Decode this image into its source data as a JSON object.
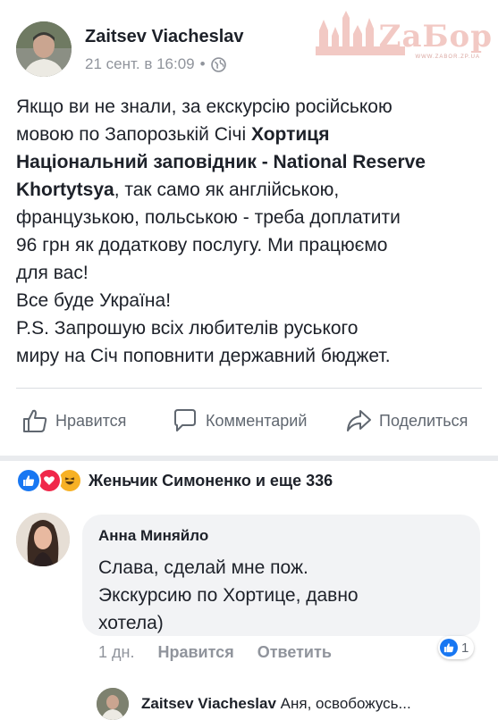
{
  "post": {
    "author": "Zaitsev Viacheslav",
    "timestamp": "21 сент. в 16:09",
    "separator": "•",
    "privacy_icon": "globe-icon",
    "body": {
      "line1": "Якщо ви не знали, за екскурсію російською",
      "line2": "мовою по Запорозькій Січі ",
      "line2_bold": "Хортиця",
      "line3_bold": "Національний заповідник - National Reserve",
      "line4_bold": "Khortytsya",
      "line4": ", так само як англійською,",
      "line5": "французькою, польською - треба доплатити",
      "line6": "96 грн як додаткову послугу. Ми працюємо",
      "line7": "для вас!",
      "line8": "Все буде Україна!",
      "line9": "P.S. Запрошую всіх любителів руського",
      "line10": "миру на Січ поповнити державний бюджет."
    }
  },
  "watermark": {
    "logo": "ZaБор",
    "url": "WWW.ZABOR.ZP.UA"
  },
  "actions": {
    "like_label": "Нравится",
    "comment_label": "Комментарий",
    "share_label": "Поделиться"
  },
  "reactions": {
    "summary": "Женьчик Симоненко и еще 336",
    "icons": [
      "like-reaction-icon",
      "love-reaction-icon",
      "haha-reaction-icon"
    ]
  },
  "comment": {
    "author": "Анна Миняйло",
    "line1": "Слава, сделай мне пож.",
    "line2": "Экскурсию по Хортице, давно",
    "line3": "хотела)",
    "age": "1 дн.",
    "like_label": "Нравится",
    "reply_label": "Ответить",
    "like_count": "1"
  },
  "reply": {
    "author": "Zaitsev Viacheslav",
    "text": "Аня, освобожусь..."
  },
  "colors": {
    "text": "#1d2129",
    "muted": "#90949c",
    "like_blue": "#1877f2",
    "love_red": "#f0284a",
    "haha_yellow": "#f7b125",
    "bubble": "#f2f3f5",
    "watermark": "#f2c9c4"
  }
}
